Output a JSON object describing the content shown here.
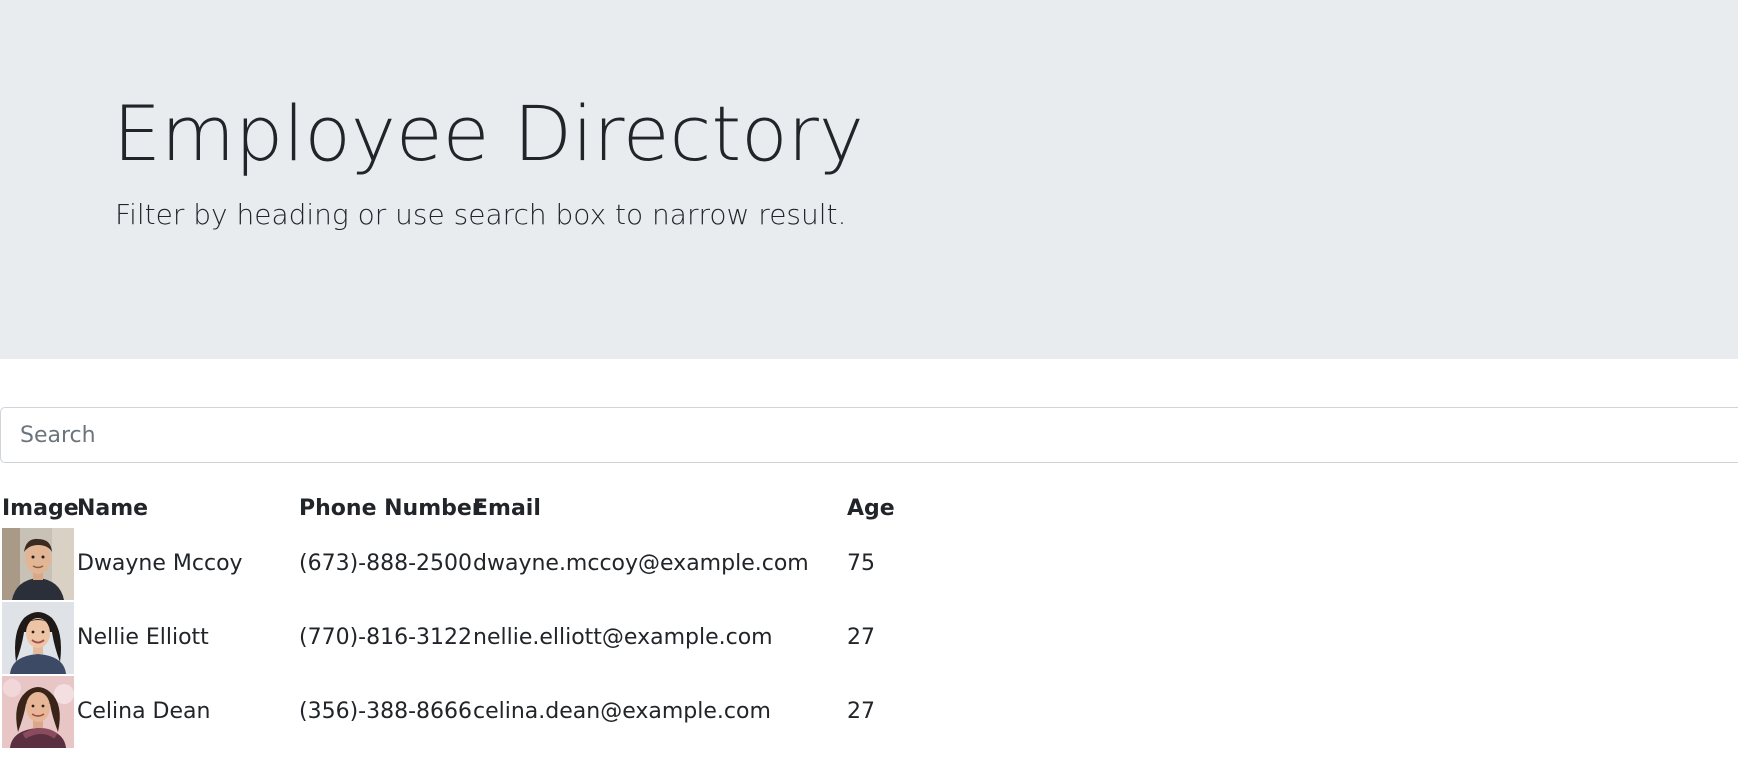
{
  "header": {
    "title": "Employee Directory",
    "lead": "Filter by heading or use search box to narrow result."
  },
  "search": {
    "placeholder": "Search",
    "value": ""
  },
  "table": {
    "columns": [
      "Image",
      "Name",
      "Phone Number",
      "Email",
      "Age"
    ],
    "rows": [
      {
        "name": "Dwayne Mccoy",
        "phone": "(673)-888-2500",
        "email": "dwayne.mccoy@example.com",
        "age": "75",
        "avatar": "avatar-icon"
      },
      {
        "name": "Nellie Elliott",
        "phone": "(770)-816-3122",
        "email": "nellie.elliott@example.com",
        "age": "27",
        "avatar": "avatar-icon"
      },
      {
        "name": "Celina Dean",
        "phone": "(356)-388-8666",
        "email": "celina.dean@example.com",
        "age": "27",
        "avatar": "avatar-icon"
      }
    ]
  },
  "colors": {
    "jumbotron_bg": "#e9ecef",
    "text": "#212529",
    "input_border": "#ced4da"
  }
}
